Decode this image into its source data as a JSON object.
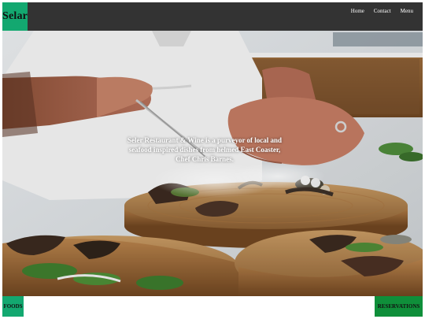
{
  "brand": {
    "name": "Selar",
    "color": "#13a870"
  },
  "nav": {
    "links": [
      "Home",
      "Contact",
      "Menu"
    ],
    "background": "#333333"
  },
  "hero": {
    "caption": "Seler Restaurant & Wine is a purveyor of local and seafood inspired dishes from helmed East Coaster, Chef Chris Barnes.",
    "image": "chef-plating-dish-photo"
  },
  "footer": {
    "left_button": "FOODS",
    "right_button": "RESERVATIONS",
    "left_color": "#13a870",
    "right_color": "#0f8f3a"
  }
}
